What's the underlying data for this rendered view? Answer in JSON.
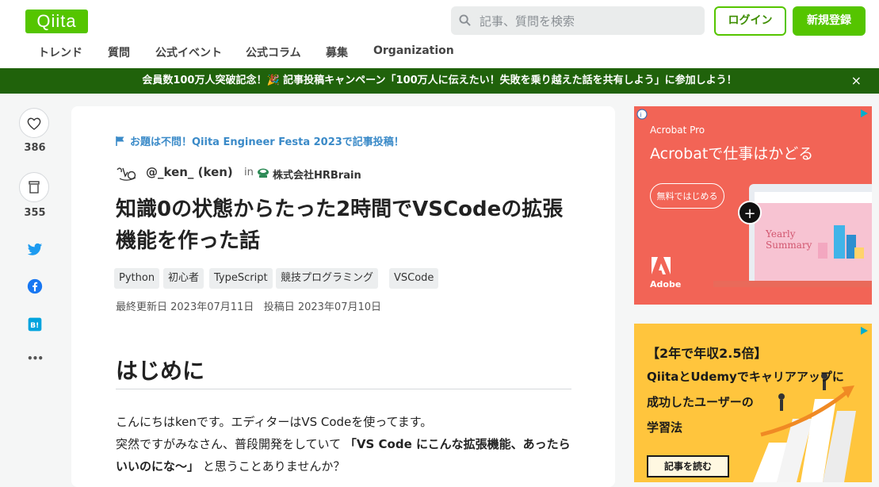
{
  "header": {
    "logo": "Qiita",
    "search_placeholder": "記事、質問を検索",
    "login_label": "ログイン",
    "signup_label": "新規登録",
    "nav": [
      "トレンド",
      "質問",
      "公式イベント",
      "公式コラム",
      "募集",
      "Organization"
    ]
  },
  "banner": {
    "text": "会員数100万人突破記念！🎉 記事投稿キャンペーン「100万人に伝えたい！失敗を乗り越えた話を共有しよう」に参加しよう！",
    "close": "×"
  },
  "sidebar": {
    "like_count": "386",
    "stock_count": "355",
    "more": "•••"
  },
  "article": {
    "event_label": "お題は不問！Qiita Engineer Festa 2023で記事投稿！",
    "author": "@_ken_ (ken)",
    "in_label": "in",
    "organization": "株式会社HRBrain",
    "title": "知識0の状態からたった2時間でVSCodeの拡張機能を作った話",
    "tags": [
      "Python",
      "初心者",
      "TypeScript",
      "競技プログラミング",
      "VSCode"
    ],
    "updated": "最終更新日 2023年07月11日",
    "posted": "投稿日 2023年07月10日",
    "heading": "はじめに",
    "para1": "こんにちはkenです。エディターはVS Codeを使ってます。",
    "para2_start": "突然ですがみなさん、普段開発をしていて",
    "para2_bold": "「VS Code にこんな拡張機能、あったらいいのにな〜」",
    "para2_end": "と思うことありませんか？"
  },
  "ads": {
    "ad1": {
      "product": "Acrobat Pro",
      "headline": "Acrobatで仕事はかどる",
      "cta": "無料ではじめる",
      "brand": "Adobe",
      "screen_title": "Yearly Summary",
      "color": "#f26456"
    },
    "ad2": {
      "line1": "【2年で年収2.5倍】",
      "line2": "QiitaとUdemyでキャリアアップに",
      "line3": "成功したユーザーの",
      "line4": "学習法",
      "cta": "記事を読む",
      "color": "#ffc53d"
    }
  }
}
